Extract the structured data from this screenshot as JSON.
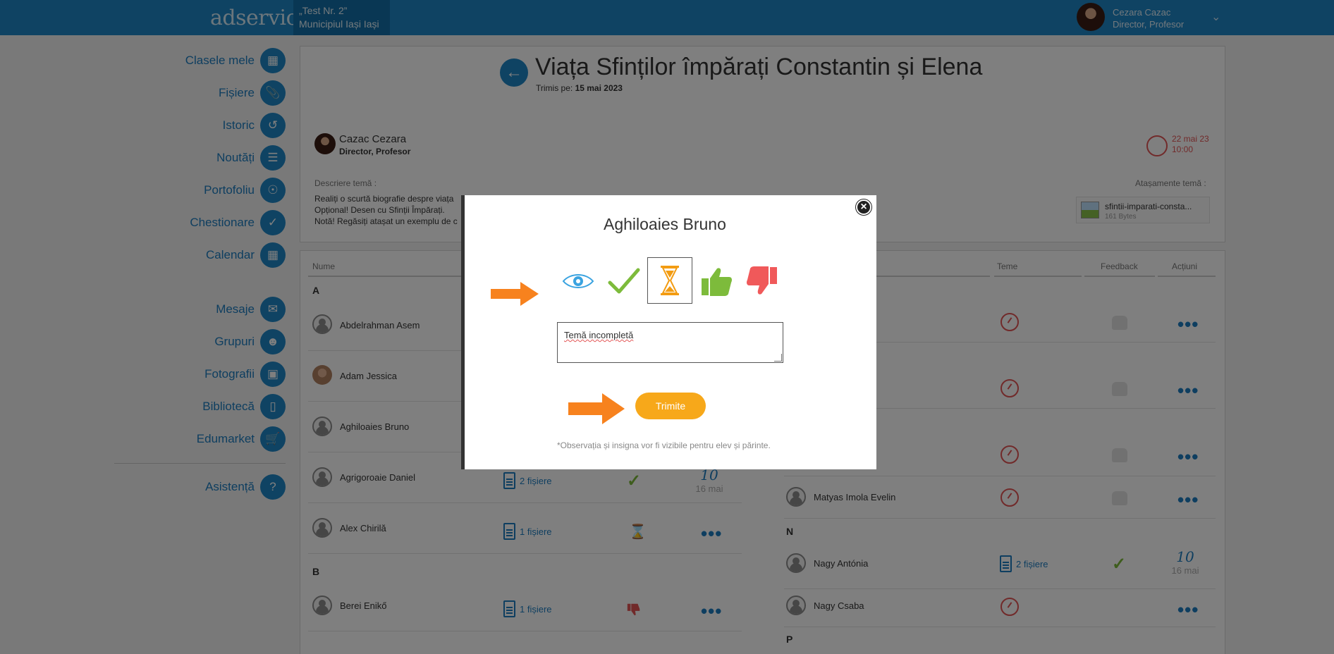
{
  "topbar": {
    "logo": "adservio",
    "school_line1": "„Test Nr. 2”",
    "school_line2": "Municipiul Iași Iași",
    "user_name": "Cezara Cazac",
    "user_role": "Director, Profesor"
  },
  "sidebar": {
    "items": [
      {
        "label": "Clasele mele",
        "icon": "classroom-icon"
      },
      {
        "label": "Fișiere",
        "icon": "paperclip-icon"
      },
      {
        "label": "Istoric",
        "icon": "history-icon"
      },
      {
        "label": "Noutăți",
        "icon": "news-icon"
      },
      {
        "label": "Portofoliu",
        "icon": "portfolio-icon"
      },
      {
        "label": "Chestionare",
        "icon": "survey-icon"
      },
      {
        "label": "Calendar",
        "icon": "calendar-icon"
      },
      {
        "label": "Mesaje",
        "icon": "mail-icon"
      },
      {
        "label": "Grupuri",
        "icon": "groups-icon"
      },
      {
        "label": "Fotografii",
        "icon": "photos-icon"
      },
      {
        "label": "Bibliotecă",
        "icon": "library-icon"
      },
      {
        "label": "Edumarket",
        "icon": "cart-icon"
      },
      {
        "label": "Asistență",
        "icon": "help-icon"
      }
    ]
  },
  "homework": {
    "title": "Viața Sfinților împărați Constantin și Elena",
    "sent_label": "Trimis pe:",
    "sent_date": "15 mai 2023",
    "author_name": "Cazac Cezara",
    "author_role": "Director, Profesor",
    "deadline_date": "22 mai 23",
    "deadline_time": "10:00",
    "description_label": "Descriere temă :",
    "description_lines": [
      "Realiți o scurtă biografie despre viața",
      "Opțional! Desen cu Sfinții Împărați.",
      "Notă! Regăsiți atașat un exemplu de c"
    ],
    "attachments_label": "Atașamente temă :",
    "attachment_name": "sfintii-imparati-consta...",
    "attachment_size": "161 Bytes"
  },
  "table": {
    "headers": {
      "name": "Nume",
      "homework": "Teme",
      "feedback": "Feedback",
      "actions": "Acțiuni"
    },
    "left_letters": [
      "A",
      "B"
    ],
    "right_letters": [
      "N",
      "P"
    ],
    "left_rows": [
      {
        "name": "Abdelrahman Asem"
      },
      {
        "name": "Adam Jessica"
      },
      {
        "name": "Aghiloaies Bruno"
      },
      {
        "name": "Agrigoroaie Daniel",
        "files": "2 fișiere",
        "grade": "10",
        "grade_date": "16 mai"
      },
      {
        "name": "Alex Chirilă",
        "files": "1 fișiere"
      },
      {
        "name": "Berei Enikő",
        "files": "1 fișiere"
      }
    ],
    "right_rows": [
      {
        "name": "Matyas Imola Evelin"
      },
      {
        "name": "Nagy Antónia",
        "files": "2 fișiere",
        "grade": "10",
        "grade_date": "16 mai"
      },
      {
        "name": "Nagy Csaba"
      }
    ]
  },
  "modal": {
    "student_name": "Aghiloaies Bruno",
    "status_options": [
      "eye-icon",
      "check-icon",
      "hourglass-icon",
      "thumbs-up-icon",
      "thumbs-down-icon"
    ],
    "selected_status": "hourglass-icon",
    "note_value": "Temă incompletă",
    "send_label": "Trimite",
    "footnote": "*Observația și insigna vor fi vizibile pentru elev și părinte.",
    "colors": {
      "accent": "#1e86c6",
      "send": "#f7a81a",
      "arrow": "#f7821e",
      "check": "#7dbb3b",
      "thumb_down": "#f0595a"
    }
  }
}
